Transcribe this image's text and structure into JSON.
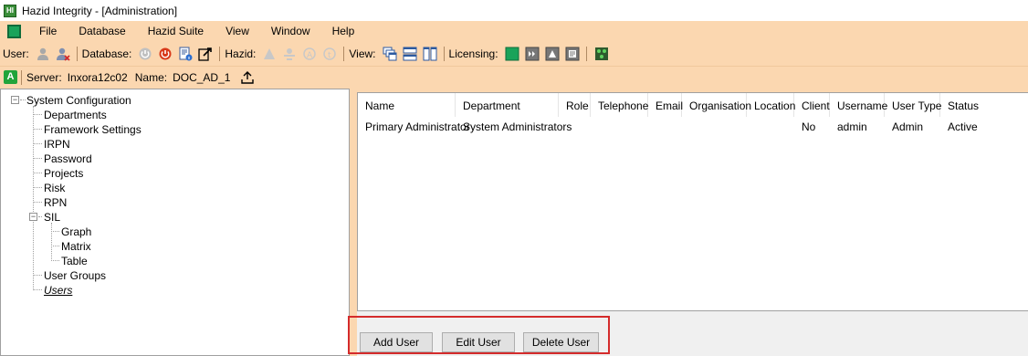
{
  "window": {
    "title": "Hazid Integrity - [Administration]"
  },
  "menu": {
    "items": [
      "File",
      "Database",
      "Hazid Suite",
      "View",
      "Window",
      "Help"
    ]
  },
  "toolbar": {
    "user_label": "User:",
    "database_label": "Database:",
    "hazid_label": "Hazid:",
    "view_label": "View:",
    "licensing_label": "Licensing:"
  },
  "serverbar": {
    "badge": "A",
    "server_label": "Server:",
    "server_value": "Inxora12c02",
    "name_label": "Name:",
    "name_value": "DOC_AD_1"
  },
  "tree": {
    "root": "System Configuration",
    "items": [
      "Departments",
      "Framework Settings",
      "IRPN",
      "Password",
      "Projects",
      "Risk",
      "RPN",
      "SIL",
      "User Groups",
      "Users"
    ],
    "sil_children": [
      "Graph",
      "Matrix",
      "Table"
    ],
    "selected": "Users"
  },
  "grid": {
    "columns": [
      "Name",
      "Department",
      "Role",
      "Telephone",
      "Email",
      "Organisation",
      "Location",
      "Client",
      "Username",
      "User Type",
      "Status"
    ],
    "rows": [
      [
        "Primary Administrator",
        "System Administrators",
        "",
        "",
        "",
        "",
        "",
        "No",
        "admin",
        "Admin",
        "Active"
      ]
    ]
  },
  "buttons": {
    "add": "Add User",
    "edit": "Edit User",
    "delete": "Delete User"
  },
  "colors": {
    "chrome": "#fbd7b0",
    "accent_green": "#1aa35a",
    "highlight_red": "#d42b2b"
  }
}
